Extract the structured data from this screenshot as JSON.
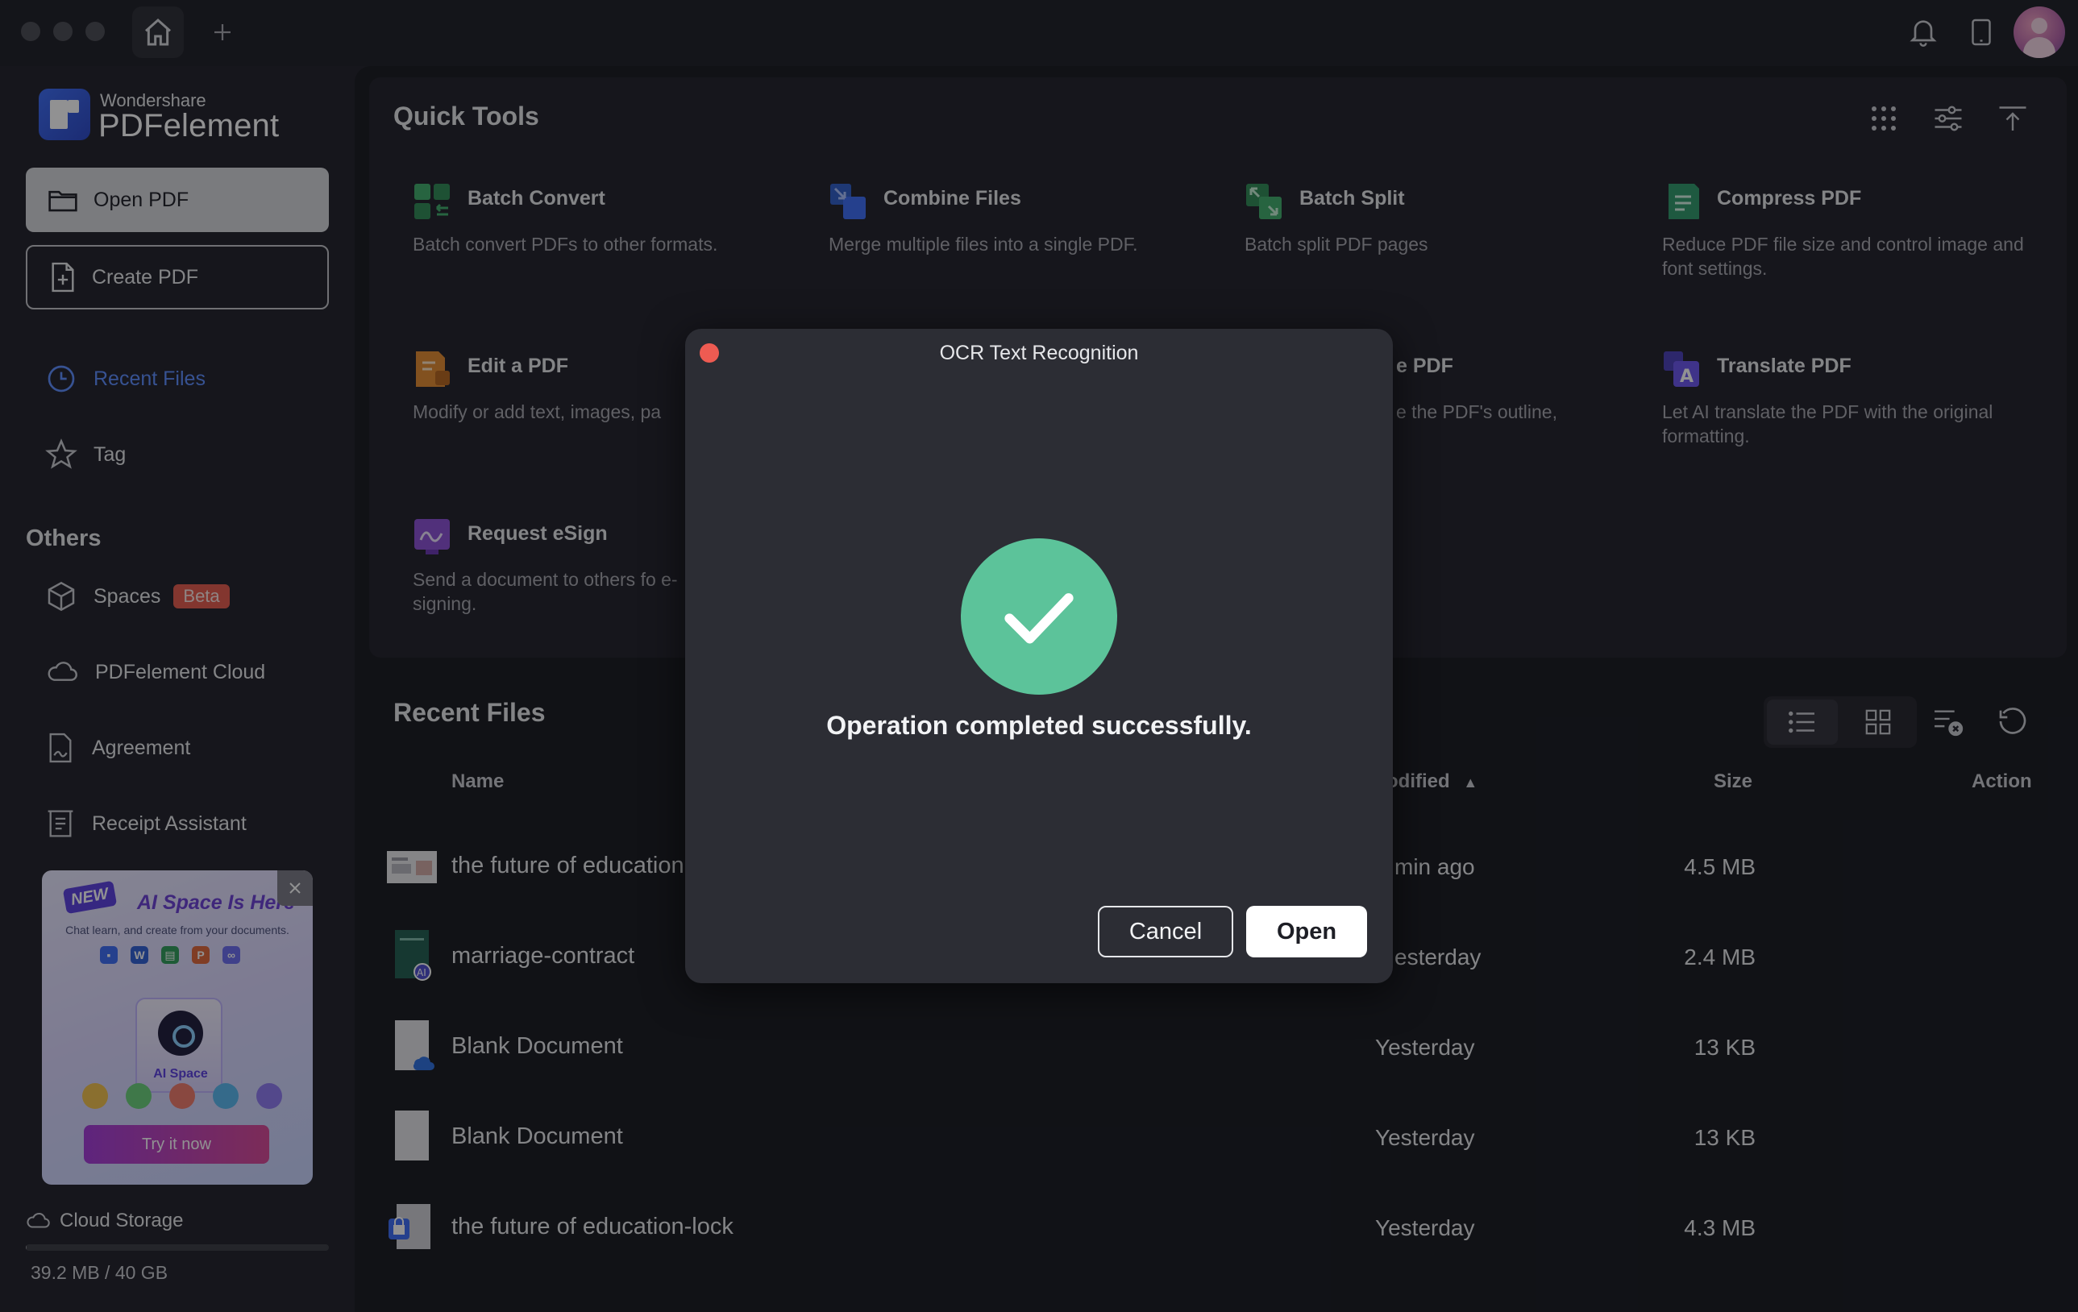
{
  "app": {
    "brand_top": "Wondershare",
    "brand_main": "PDFelement"
  },
  "sidebar": {
    "open_pdf": "Open PDF",
    "create_pdf": "Create PDF",
    "nav": [
      {
        "label": "Recent Files",
        "active": true
      },
      {
        "label": "Tag",
        "active": false
      }
    ],
    "others_title": "Others",
    "others": [
      {
        "label": "Spaces",
        "badge": "Beta"
      },
      {
        "label": "PDFelement Cloud"
      },
      {
        "label": "Agreement"
      },
      {
        "label": "Receipt Assistant"
      }
    ],
    "promo": {
      "new_tag": "NEW",
      "title": "AI Space Is Here",
      "subtitle": "Chat learn, and create from your documents.",
      "card_label": "AI Space",
      "cta": "Try it now"
    },
    "cloud_storage_label": "Cloud Storage",
    "storage_used": "39.2 MB / 40 GB",
    "storage_fraction": 0.001
  },
  "quick_tools": {
    "title": "Quick Tools",
    "tools": [
      {
        "name": "Batch Convert",
        "desc": "Batch convert PDFs to other formats."
      },
      {
        "name": "Combine Files",
        "desc": "Merge multiple files into a single PDF."
      },
      {
        "name": "Batch Split",
        "desc": "Batch split PDF pages"
      },
      {
        "name": "Compress PDF",
        "desc": "Reduce PDF file size and control image and font settings."
      },
      {
        "name": "Edit a PDF",
        "desc": "Modify or add text, images, pa"
      },
      {
        "name": "e PDF",
        "desc": "e the PDF's outline,"
      },
      {
        "name": "Translate PDF",
        "desc": "Let AI translate the PDF with the original formatting."
      },
      {
        "name": "Request eSign",
        "desc": "Send a document to others fo e-signing."
      }
    ]
  },
  "recent": {
    "title": "Recent Files",
    "columns": {
      "name": "Name",
      "modified": "odified",
      "size": "Size",
      "action": "Action"
    },
    "rows": [
      {
        "name": "the future of education",
        "modified": "min ago",
        "size": "4.5 MB"
      },
      {
        "name": "marriage-contract",
        "modified": "esterday",
        "size": "2.4 MB"
      },
      {
        "name": "Blank Document",
        "modified": "Yesterday",
        "size": "13 KB"
      },
      {
        "name": "Blank Document",
        "modified": "Yesterday",
        "size": "13 KB"
      },
      {
        "name": "the future of education-lock",
        "modified": "Yesterday",
        "size": "4.3 MB"
      }
    ]
  },
  "dialog": {
    "title": "OCR Text Recognition",
    "message": "Operation completed successfully.",
    "cancel": "Cancel",
    "open": "Open"
  },
  "colors": {
    "accent": "#5b8cff",
    "success": "#5cc39a",
    "badge": "#e55a4c"
  }
}
